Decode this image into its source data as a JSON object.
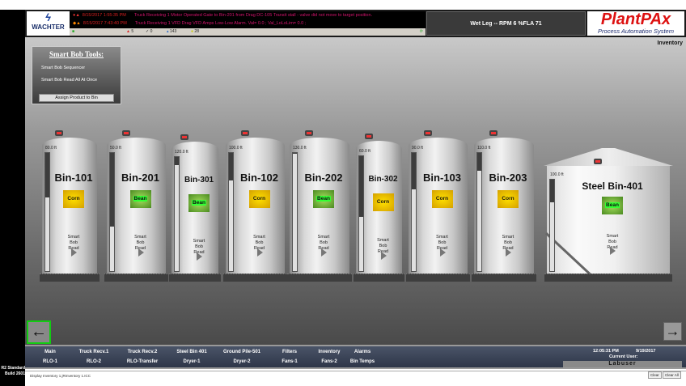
{
  "header": {
    "logo_text": "WACHTER",
    "alarms": [
      {
        "datetime": "8/15/2017 1:55:35 PM",
        "message": "Truck Receiving 1 Motor Operated Gate to Bin-201 from Drag DC-105 Transit stall - valve did not move to target position."
      },
      {
        "datetime": "8/15/2017 7:43:40 PM",
        "message": "Truck Receiving 1 VFD Drag VFD Amps Low-Low Alarm.   Val= 0.0 ; Val_LoLoLim= 0.0 ;"
      }
    ],
    "alarm_counts": {
      "active": "5",
      "ack": "0",
      "shelved": "143",
      "suppressed": "28"
    },
    "wet_leg": "Wet Leg --   RPM  6    %FLA   71",
    "brand": "PlantPAx",
    "brand_sub": "Process Automation System",
    "page_title": "Inventory"
  },
  "smart_bob_tools": {
    "title": "Smart Bob Tools:",
    "items": [
      "Smart Bob Sequencer",
      "Smart Bob Read All At Once"
    ],
    "assign_button": "Assign Product to Bin"
  },
  "bins": [
    {
      "name": "Bin-101",
      "height_label": "80.0 ft",
      "product": "Corn",
      "level_fraction": 0.62,
      "action": "Smart Bob Read"
    },
    {
      "name": "Bin-201",
      "height_label": "50.0 ft",
      "product": "Bean",
      "level_fraction": 0.38,
      "action": "Smart Bob Read"
    },
    {
      "name": "Bin-301",
      "height_label": "120.0 ft",
      "product": "Bean",
      "level_fraction": 0.93,
      "action": "Smart Bob Read"
    },
    {
      "name": "Bin-102",
      "height_label": "100.0 ft",
      "product": "Corn",
      "level_fraction": 0.77,
      "action": "Smart Bob Read"
    },
    {
      "name": "Bin-202",
      "height_label": "130.0 ft",
      "product": "Bean",
      "level_fraction": 0.99,
      "action": "Smart Bob Read"
    },
    {
      "name": "Bin-302",
      "height_label": "60.0 ft",
      "product": "Corn",
      "level_fraction": 0.47,
      "action": "Smart Bob Read"
    },
    {
      "name": "Bin-103",
      "height_label": "90.0 ft",
      "product": "Corn",
      "level_fraction": 0.69,
      "action": "Smart Bob Read"
    },
    {
      "name": "Bin-203",
      "height_label": "110.0 ft",
      "product": "Corn",
      "level_fraction": 0.85,
      "action": "Smart Bob Read"
    },
    {
      "name": "Steel Bin-401",
      "height_label": "100.0 ft",
      "product": "Bean",
      "level_fraction": 0.75,
      "action": "Smart Bob Read"
    }
  ],
  "nav": {
    "row1": [
      "Main",
      "Truck Recv.1",
      "Truck Recv.2",
      "Steel Bin 401",
      "Ground Pile-501",
      "Filters",
      "Inventory",
      "Alarms"
    ],
    "row2": [
      "RLO-1",
      "RLO-2",
      "RLO-Transfer",
      "Dryer-1",
      "Dryer-2",
      "Fans-1",
      "Fans-2",
      "Bin Temps"
    ],
    "back": "←",
    "forward": "→"
  },
  "clock": {
    "time": "12:05:31 PM",
    "date": "9/19/2017",
    "user_label": "Current User:",
    "user": "Labuser"
  },
  "status": {
    "text": "Display Inventory  1.jRInventory  1.ICC",
    "clear": "Clear",
    "clear_all": "Clear All"
  },
  "build": {
    "edition": "R2 Standard",
    "build": "Build 2601"
  }
}
